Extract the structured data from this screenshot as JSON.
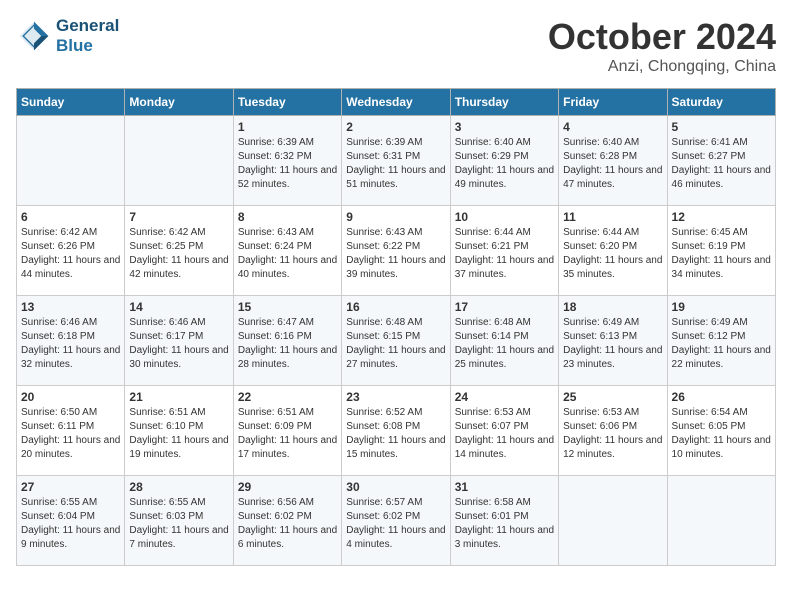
{
  "header": {
    "logo_line1": "General",
    "logo_line2": "Blue",
    "month": "October 2024",
    "location": "Anzi, Chongqing, China"
  },
  "days_of_week": [
    "Sunday",
    "Monday",
    "Tuesday",
    "Wednesday",
    "Thursday",
    "Friday",
    "Saturday"
  ],
  "weeks": [
    [
      {
        "day": "",
        "info": ""
      },
      {
        "day": "",
        "info": ""
      },
      {
        "day": "1",
        "info": "Sunrise: 6:39 AM\nSunset: 6:32 PM\nDaylight: 11 hours and 52 minutes."
      },
      {
        "day": "2",
        "info": "Sunrise: 6:39 AM\nSunset: 6:31 PM\nDaylight: 11 hours and 51 minutes."
      },
      {
        "day": "3",
        "info": "Sunrise: 6:40 AM\nSunset: 6:29 PM\nDaylight: 11 hours and 49 minutes."
      },
      {
        "day": "4",
        "info": "Sunrise: 6:40 AM\nSunset: 6:28 PM\nDaylight: 11 hours and 47 minutes."
      },
      {
        "day": "5",
        "info": "Sunrise: 6:41 AM\nSunset: 6:27 PM\nDaylight: 11 hours and 46 minutes."
      }
    ],
    [
      {
        "day": "6",
        "info": "Sunrise: 6:42 AM\nSunset: 6:26 PM\nDaylight: 11 hours and 44 minutes."
      },
      {
        "day": "7",
        "info": "Sunrise: 6:42 AM\nSunset: 6:25 PM\nDaylight: 11 hours and 42 minutes."
      },
      {
        "day": "8",
        "info": "Sunrise: 6:43 AM\nSunset: 6:24 PM\nDaylight: 11 hours and 40 minutes."
      },
      {
        "day": "9",
        "info": "Sunrise: 6:43 AM\nSunset: 6:22 PM\nDaylight: 11 hours and 39 minutes."
      },
      {
        "day": "10",
        "info": "Sunrise: 6:44 AM\nSunset: 6:21 PM\nDaylight: 11 hours and 37 minutes."
      },
      {
        "day": "11",
        "info": "Sunrise: 6:44 AM\nSunset: 6:20 PM\nDaylight: 11 hours and 35 minutes."
      },
      {
        "day": "12",
        "info": "Sunrise: 6:45 AM\nSunset: 6:19 PM\nDaylight: 11 hours and 34 minutes."
      }
    ],
    [
      {
        "day": "13",
        "info": "Sunrise: 6:46 AM\nSunset: 6:18 PM\nDaylight: 11 hours and 32 minutes."
      },
      {
        "day": "14",
        "info": "Sunrise: 6:46 AM\nSunset: 6:17 PM\nDaylight: 11 hours and 30 minutes."
      },
      {
        "day": "15",
        "info": "Sunrise: 6:47 AM\nSunset: 6:16 PM\nDaylight: 11 hours and 28 minutes."
      },
      {
        "day": "16",
        "info": "Sunrise: 6:48 AM\nSunset: 6:15 PM\nDaylight: 11 hours and 27 minutes."
      },
      {
        "day": "17",
        "info": "Sunrise: 6:48 AM\nSunset: 6:14 PM\nDaylight: 11 hours and 25 minutes."
      },
      {
        "day": "18",
        "info": "Sunrise: 6:49 AM\nSunset: 6:13 PM\nDaylight: 11 hours and 23 minutes."
      },
      {
        "day": "19",
        "info": "Sunrise: 6:49 AM\nSunset: 6:12 PM\nDaylight: 11 hours and 22 minutes."
      }
    ],
    [
      {
        "day": "20",
        "info": "Sunrise: 6:50 AM\nSunset: 6:11 PM\nDaylight: 11 hours and 20 minutes."
      },
      {
        "day": "21",
        "info": "Sunrise: 6:51 AM\nSunset: 6:10 PM\nDaylight: 11 hours and 19 minutes."
      },
      {
        "day": "22",
        "info": "Sunrise: 6:51 AM\nSunset: 6:09 PM\nDaylight: 11 hours and 17 minutes."
      },
      {
        "day": "23",
        "info": "Sunrise: 6:52 AM\nSunset: 6:08 PM\nDaylight: 11 hours and 15 minutes."
      },
      {
        "day": "24",
        "info": "Sunrise: 6:53 AM\nSunset: 6:07 PM\nDaylight: 11 hours and 14 minutes."
      },
      {
        "day": "25",
        "info": "Sunrise: 6:53 AM\nSunset: 6:06 PM\nDaylight: 11 hours and 12 minutes."
      },
      {
        "day": "26",
        "info": "Sunrise: 6:54 AM\nSunset: 6:05 PM\nDaylight: 11 hours and 10 minutes."
      }
    ],
    [
      {
        "day": "27",
        "info": "Sunrise: 6:55 AM\nSunset: 6:04 PM\nDaylight: 11 hours and 9 minutes."
      },
      {
        "day": "28",
        "info": "Sunrise: 6:55 AM\nSunset: 6:03 PM\nDaylight: 11 hours and 7 minutes."
      },
      {
        "day": "29",
        "info": "Sunrise: 6:56 AM\nSunset: 6:02 PM\nDaylight: 11 hours and 6 minutes."
      },
      {
        "day": "30",
        "info": "Sunrise: 6:57 AM\nSunset: 6:02 PM\nDaylight: 11 hours and 4 minutes."
      },
      {
        "day": "31",
        "info": "Sunrise: 6:58 AM\nSunset: 6:01 PM\nDaylight: 11 hours and 3 minutes."
      },
      {
        "day": "",
        "info": ""
      },
      {
        "day": "",
        "info": ""
      }
    ]
  ]
}
